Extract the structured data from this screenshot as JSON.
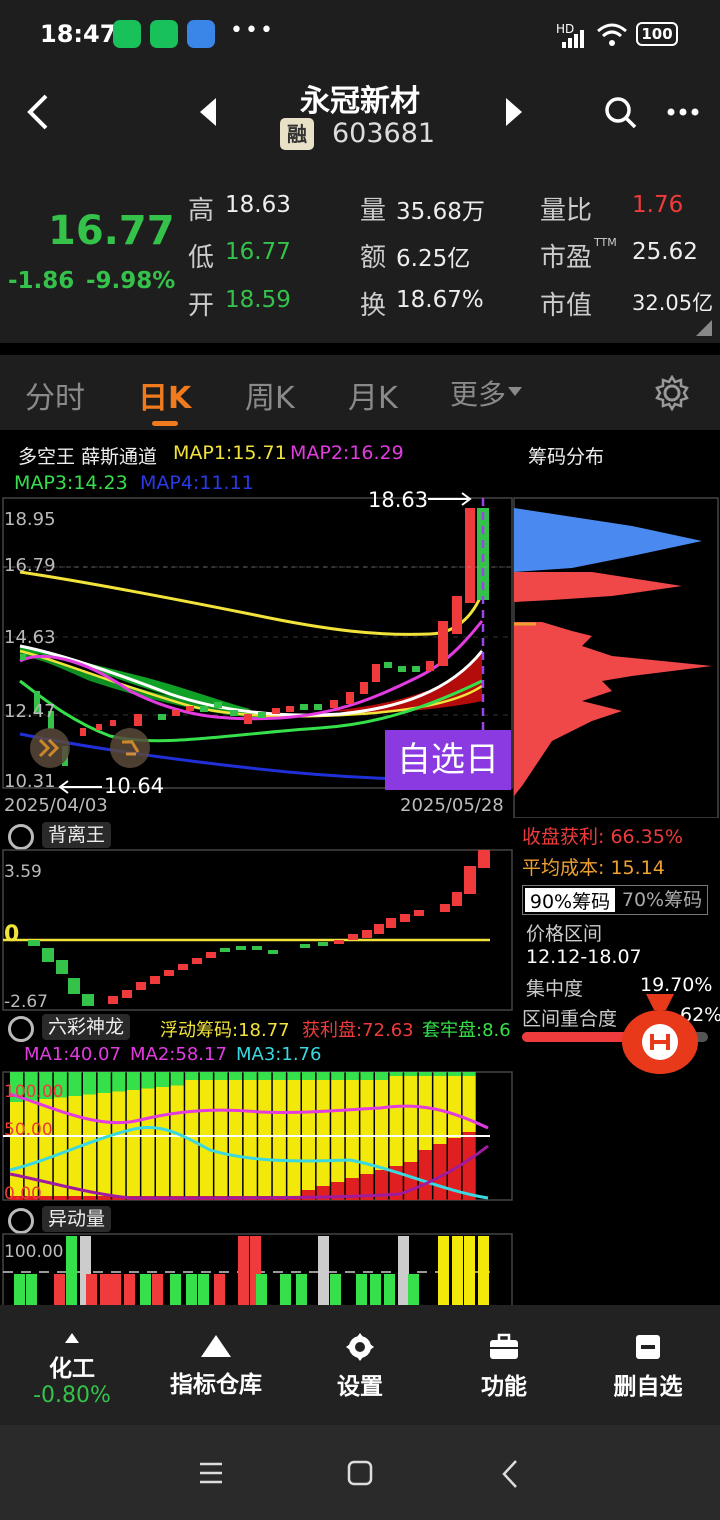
{
  "status": {
    "time": "18:47",
    "signal": "HD",
    "battery": "100",
    "more": "•••"
  },
  "nav": {
    "stock_name": "永冠新材",
    "badge": "融",
    "stock_code": "603681"
  },
  "quote": {
    "price": "16.77",
    "change": "-1.86",
    "change_pct": "-9.98%",
    "high_label": "高",
    "high": "18.63",
    "low_label": "低",
    "low": "16.77",
    "open_label": "开",
    "open": "18.59",
    "volume_label": "量",
    "volume": "35.68万",
    "amount_label": "额",
    "amount": "6.25亿",
    "turnover_label": "换",
    "turnover": "18.67%",
    "vol_ratio_label": "量比",
    "vol_ratio": "1.76",
    "pe_label": "市盈",
    "pe_sup": "TTM",
    "pe": "25.62",
    "mktcap_label": "市值",
    "mktcap": "32.05亿"
  },
  "tabs": [
    "分时",
    "日K",
    "周K",
    "月K",
    "更多"
  ],
  "main_chart": {
    "indicator": "多空王 薛斯通道",
    "map1": "MAP1:15.71",
    "map2": "MAP2:16.29",
    "map3": "MAP3:14.23",
    "map4": "MAP4:11.11",
    "y_labels": [
      "18.95",
      "16.79",
      "14.63",
      "12.47",
      "10.31"
    ],
    "x_start": "2025/04/03",
    "x_end": "2025/05/28",
    "high_mark": "18.63",
    "low_mark": "10.64",
    "selfselect_tag": "自选日"
  },
  "chip": {
    "title": "筹码分布",
    "profit_label": "收盘获利: 66.35%",
    "avg_cost_label": "平均成本: 15.14",
    "tab90": "90%筹码",
    "tab70": "70%筹码",
    "range_label": "价格区间",
    "range_value": "12.12-18.07",
    "concentration_label": "集中度",
    "concentration_value": "19.70%",
    "overlap_label": "区间重合度",
    "overlap_value": "62%"
  },
  "ind1": {
    "name": "背离王",
    "y_top": "3.59",
    "y_zero": "0",
    "y_bottom": "-2.67"
  },
  "ind2": {
    "name": "六彩神龙",
    "float": "浮动筹码:18.77",
    "profit": "获利盘:72.63",
    "trap": "套牢盘:8.6",
    "ma1": "MA1:40.07",
    "ma2": "MA2:58.17",
    "ma3": "MA3:1.76",
    "y100": "100.00",
    "y50": "50.00",
    "y0": "0.00"
  },
  "ind3": {
    "name": "异动量",
    "y_label": "100.00"
  },
  "toolbar": {
    "sector": "化工",
    "sector_change": "-0.80%",
    "indicator_lib": "指标仓库",
    "settings": "设置",
    "functions": "功能",
    "remove": "删自选"
  },
  "colors": {
    "up": "#ef3b3b",
    "down": "#35c24a",
    "accent": "#f07a1e",
    "purple": "#8a3ae0"
  }
}
